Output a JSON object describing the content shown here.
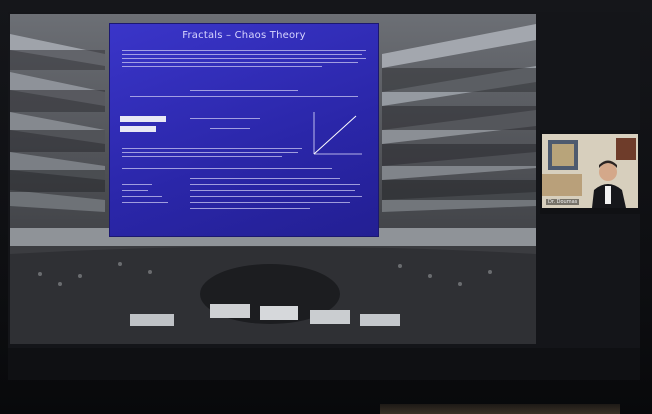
{
  "shared_screen": {
    "slide": {
      "title": "Fractals – Chaos Theory"
    }
  },
  "presenter": {
    "name_label": "Dr. Doumas"
  },
  "colors": {
    "slide_bg": "#2a26a8",
    "slide_text": "#d8d6ff",
    "screen_bg": "#141519"
  }
}
